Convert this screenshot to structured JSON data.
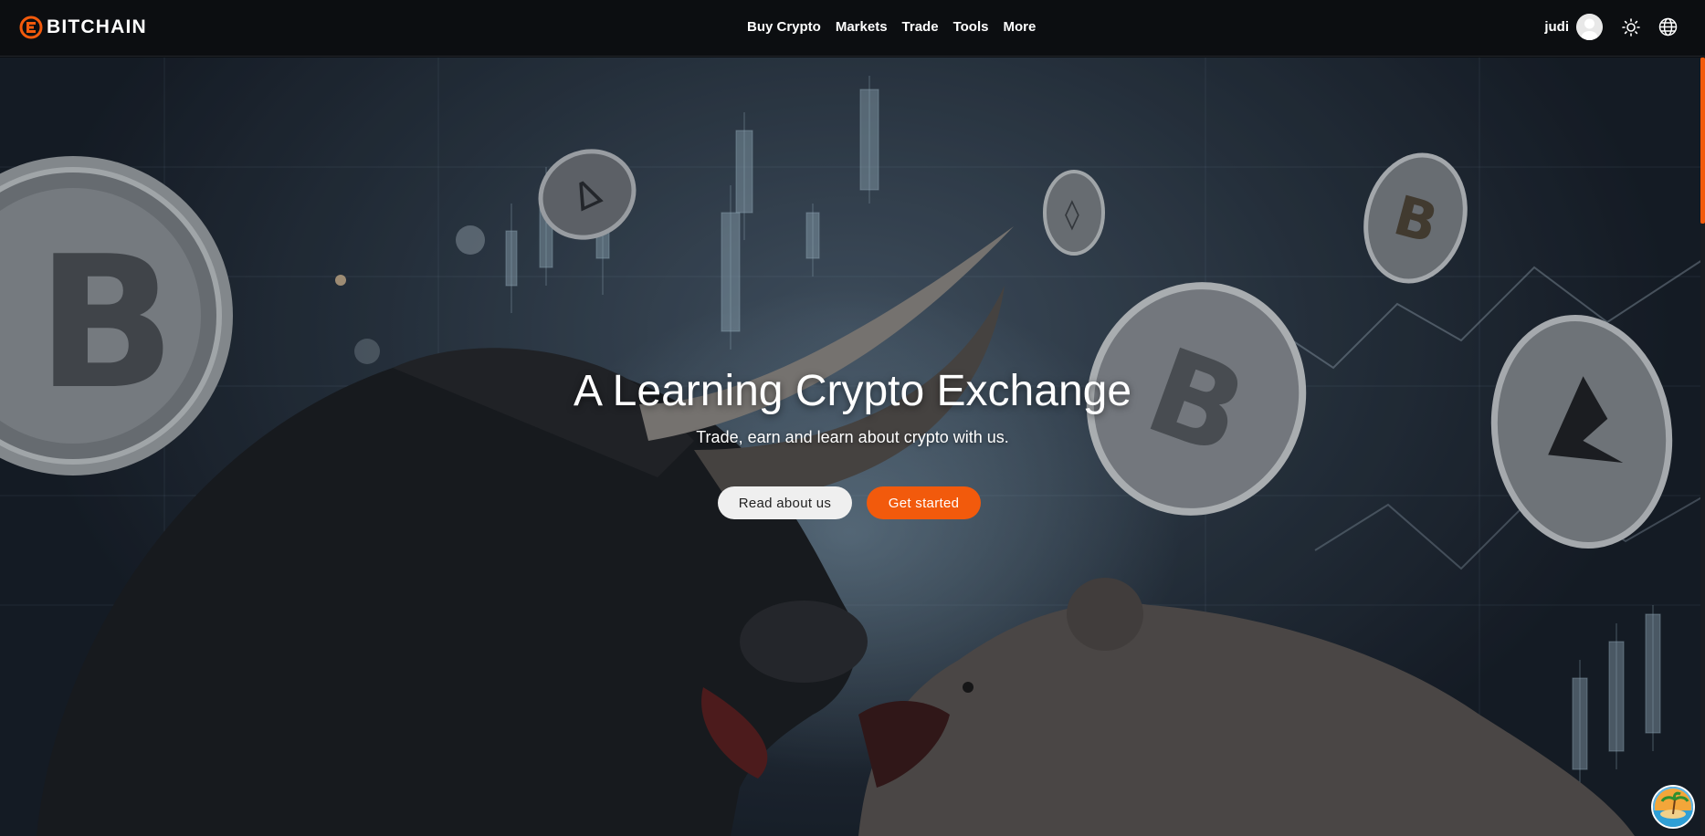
{
  "brand": {
    "name": "BITCHAIN",
    "accent": "#f25a0c"
  },
  "nav": {
    "links": [
      "Buy Crypto",
      "Markets",
      "Trade",
      "Tools",
      "More"
    ]
  },
  "user": {
    "name": "judi"
  },
  "icons": {
    "theme": "sun-icon",
    "language": "globe-icon",
    "avatar": "user-avatar",
    "badge": "beach-island-icon"
  },
  "hero": {
    "title": "A Learning Crypto Exchange",
    "subtitle": "Trade, earn and learn about crypto with us.",
    "buttons": {
      "about": "Read about us",
      "start": "Get started"
    }
  }
}
